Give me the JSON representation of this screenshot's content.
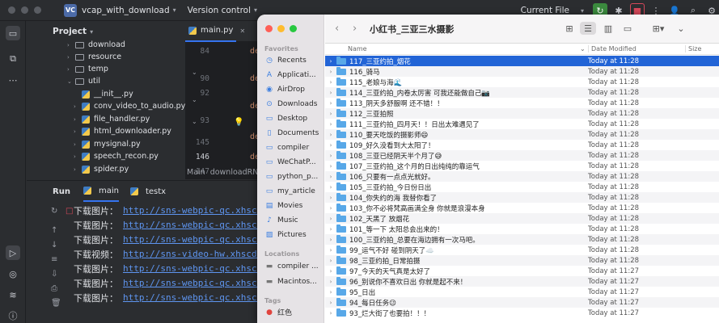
{
  "ide": {
    "project_badge": "VC",
    "project_name": "vcap_with_download",
    "vcs_label": "Version control",
    "run_config": "Current File"
  },
  "project_panel": {
    "title": "Project",
    "tree": [
      {
        "label": "download",
        "type": "folder",
        "level": 1,
        "expanded": false
      },
      {
        "label": "resource",
        "type": "folder",
        "level": 1,
        "expanded": false
      },
      {
        "label": "temp",
        "type": "folder",
        "level": 1,
        "expanded": false
      },
      {
        "label": "util",
        "type": "folder",
        "level": 1,
        "expanded": true
      },
      {
        "label": "__init__.py",
        "type": "file",
        "level": 2
      },
      {
        "label": "conv_video_to_audio.py",
        "type": "file",
        "level": 2
      },
      {
        "label": "file_handler.py",
        "type": "file",
        "level": 2
      },
      {
        "label": "html_downloader.py",
        "type": "file",
        "level": 2
      },
      {
        "label": "mysignal.py",
        "type": "file",
        "level": 2
      },
      {
        "label": "speech_recon.py",
        "type": "file",
        "level": 2
      },
      {
        "label": "spider.py",
        "type": "file",
        "level": 2
      }
    ]
  },
  "editor": {
    "tabs": [
      {
        "label": "main.py",
        "active": true
      },
      {
        "label": "✕",
        "active": false
      }
    ],
    "line_numbers": [
      "84",
      "90",
      "92",
      "93",
      "145",
      "146",
      "147",
      "148"
    ],
    "code_fragments": [
      "de",
      "de",
      "de",
      "de",
      "de"
    ],
    "breadcrumbs": [
      "Main",
      "downloadRN"
    ]
  },
  "run_panel": {
    "title": "Run",
    "tabs": [
      {
        "label": "main",
        "active": true
      },
      {
        "label": "testx",
        "active": false
      }
    ],
    "lines": [
      {
        "label": "下载图片：",
        "url": "http://sns-webpic-qc.xhscdn"
      },
      {
        "label": "下载图片：",
        "url": "http://sns-webpic-qc.xhscdn"
      },
      {
        "label": "下载图片：",
        "url": "http://sns-webpic-qc.xhscdn"
      },
      {
        "label": "下载视频：",
        "url": "http://sns-video-hw.xhscdn."
      },
      {
        "label": "下载图片：",
        "url": "http://sns-webpic-qc.xhscdn"
      },
      {
        "label": "下载图片：",
        "url": "http://sns-webpic-qc.xhscdn"
      },
      {
        "label": "下载图片：",
        "url": "http://sns-webpic-qc.xhscdn"
      }
    ]
  },
  "finder": {
    "title": "小红书_三亚三水摄影",
    "sidebar": {
      "favorites_label": "Favorites",
      "favorites": [
        {
          "label": "Recents",
          "icon": "clock-icon"
        },
        {
          "label": "Applicati...",
          "icon": "applications-icon"
        },
        {
          "label": "AirDrop",
          "icon": "airdrop-icon"
        },
        {
          "label": "Downloads",
          "icon": "download-icon"
        },
        {
          "label": "Desktop",
          "icon": "desktop-icon"
        },
        {
          "label": "Documents",
          "icon": "document-icon"
        },
        {
          "label": "compiler",
          "icon": "folder-icon"
        },
        {
          "label": "WeChatP...",
          "icon": "folder-icon"
        },
        {
          "label": "python_p...",
          "icon": "folder-icon"
        },
        {
          "label": "my_article",
          "icon": "folder-icon"
        },
        {
          "label": "Movies",
          "icon": "movies-icon"
        },
        {
          "label": "Music",
          "icon": "music-icon"
        },
        {
          "label": "Pictures",
          "icon": "pictures-icon"
        }
      ],
      "locations_label": "Locations",
      "locations": [
        {
          "label": "compiler ...",
          "icon": "drive-icon"
        },
        {
          "label": "Macintos...",
          "icon": "drive-icon"
        }
      ],
      "tags_label": "Tags",
      "tags": [
        {
          "label": "红色",
          "color": "#e0443e"
        }
      ]
    },
    "columns": {
      "name": "Name",
      "date": "Date Modified",
      "size": "Size"
    },
    "rows": [
      {
        "name": "117_三亚约拍_烟花",
        "date": "Today at 11:28",
        "selected": true
      },
      {
        "name": "116_骑马",
        "date": "Today at 11:28"
      },
      {
        "name": "115_老娘与海🌊",
        "date": "Today at 11:28"
      },
      {
        "name": "114_三亚约拍_内卷太厉害 可我还能做自己📷",
        "date": "Today at 11:28"
      },
      {
        "name": "113_阴天多舒服啊 还不错！！",
        "date": "Today at 11:28"
      },
      {
        "name": "112_三亚拍照",
        "date": "Today at 11:28"
      },
      {
        "name": "111_三亚约拍_四月天！！日出太难遇见了",
        "date": "Today at 11:28"
      },
      {
        "name": "110_要天吃饭的摄影师😄",
        "date": "Today at 11:28"
      },
      {
        "name": "109_好久没看到大太阳了！",
        "date": "Today at 11:28"
      },
      {
        "name": "108_三亚已经阴天半个月了😅",
        "date": "Today at 11:28"
      },
      {
        "name": "107_三亚约拍_这个月的日出纯纯的靠运气",
        "date": "Today at 11:28"
      },
      {
        "name": "106_只要有一点点光就好。",
        "date": "Today at 11:28"
      },
      {
        "name": "105_三亚约拍_今日份日出",
        "date": "Today at 11:28"
      },
      {
        "name": "104_你失约的海 我替你看了",
        "date": "Today at 11:28"
      },
      {
        "name": "103_你不必将梵高画满全身 你就是浪漫本身",
        "date": "Today at 11:28"
      },
      {
        "name": "102_天黑了 放烟花",
        "date": "Today at 11:28"
      },
      {
        "name": "101_等一下 太阳总会出来的！",
        "date": "Today at 11:28"
      },
      {
        "name": "100_三亚约拍_总要在海边拥有一次马吧。",
        "date": "Today at 11:28"
      },
      {
        "name": "99_运气不好 碰到阴天了☁️",
        "date": "Today at 11:28"
      },
      {
        "name": "98_三亚约拍_日常拍摄",
        "date": "Today at 11:28"
      },
      {
        "name": "97_今天的天气真是太好了",
        "date": "Today at 11:27"
      },
      {
        "name": "96_别说你不喜欢日出 你就是起不来！",
        "date": "Today at 11:27"
      },
      {
        "name": "95_日出",
        "date": "Today at 11:27"
      },
      {
        "name": "94_每日任务😉",
        "date": "Today at 11:27"
      },
      {
        "name": "93_烂大街了也要拍！！！",
        "date": "Today at 11:27"
      }
    ]
  }
}
